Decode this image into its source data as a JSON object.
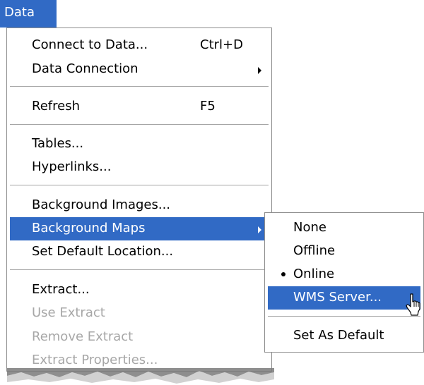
{
  "menubar": {
    "data_label": "Data"
  },
  "menu": {
    "connect_to_data": {
      "label": "Connect to Data...",
      "shortcut": "Ctrl+D"
    },
    "data_connection": {
      "label": "Data Connection"
    },
    "refresh": {
      "label": "Refresh",
      "shortcut": "F5"
    },
    "tables": {
      "label": "Tables..."
    },
    "hyperlinks": {
      "label": "Hyperlinks..."
    },
    "background_images": {
      "label": "Background Images..."
    },
    "background_maps": {
      "label": "Background Maps"
    },
    "set_default_location": {
      "label": "Set Default Location..."
    },
    "extract": {
      "label": "Extract..."
    },
    "use_extract": {
      "label": "Use Extract"
    },
    "remove_extract": {
      "label": "Remove Extract"
    },
    "extract_properties": {
      "label": "Extract Properties..."
    }
  },
  "submenu": {
    "none": {
      "label": "None"
    },
    "offline": {
      "label": "Offline"
    },
    "online": {
      "label": "Online",
      "checked": true
    },
    "wms_server": {
      "label": "WMS Server..."
    },
    "set_as_default": {
      "label": "Set As Default"
    }
  },
  "colors": {
    "highlight": "#316ac5",
    "disabled_text": "#a7a7a7"
  }
}
